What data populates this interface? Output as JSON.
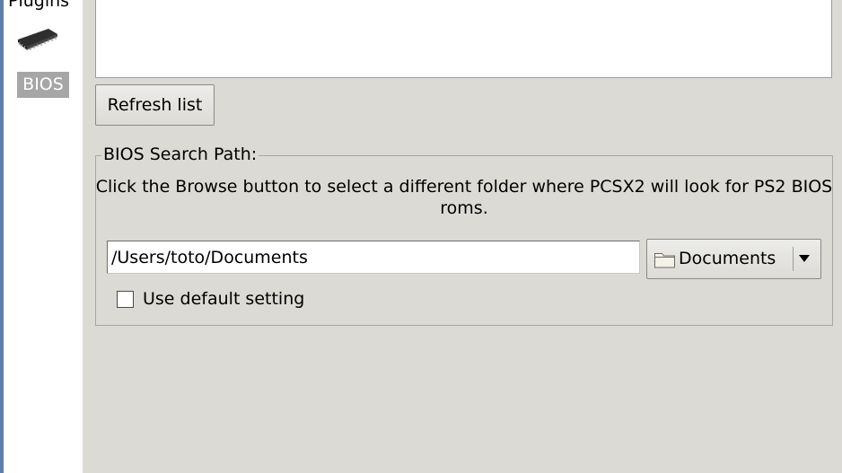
{
  "sidebar": {
    "plugins_label": "Plugins",
    "chip_icon": "cpu-chip-icon",
    "bios_label": "BIOS"
  },
  "bios_list": {
    "refresh_label": "Refresh list"
  },
  "search_path": {
    "group_title": "BIOS Search Path:",
    "help_text": "Click the Browse button to select a different folder where PCSX2 will look for PS2 BIOS roms.",
    "path_value": "/Users/toto/Documents",
    "folder_label": "Documents",
    "folder_icon": "folder-icon",
    "dropdown_icon": "chevron-down-icon",
    "use_default_label": "Use default setting",
    "use_default_checked": false
  },
  "colors": {
    "background": "#dcdad5",
    "selected_item": "#a6a6a6",
    "window_edge": "#5a7fa8"
  }
}
